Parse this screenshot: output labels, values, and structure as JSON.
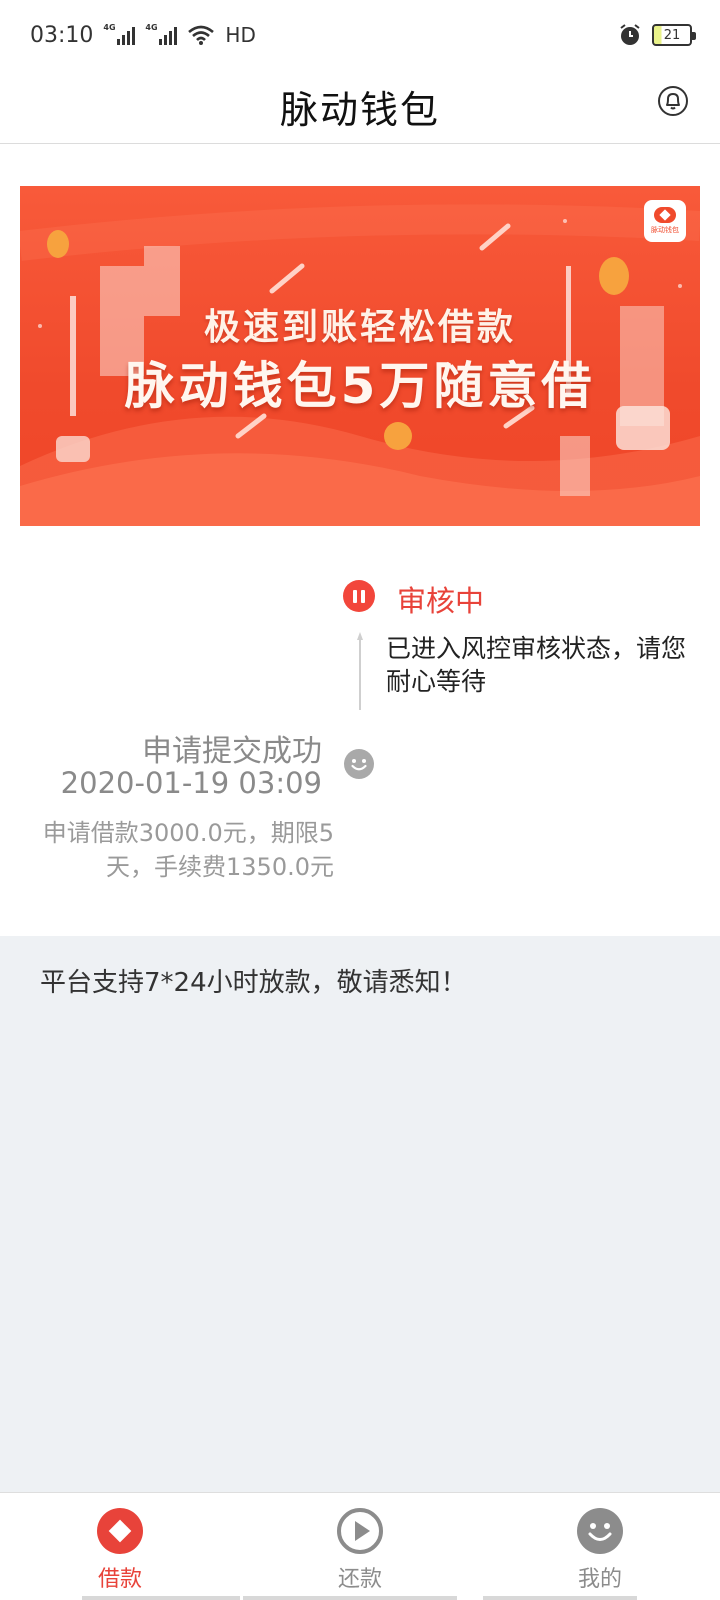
{
  "status_bar": {
    "time": "03:10",
    "network_1": "4G",
    "network_2": "4G",
    "hd": "HD",
    "battery": "21"
  },
  "header": {
    "title": "脉动钱包"
  },
  "banner": {
    "line1": "极速到账轻松借款",
    "line2": "脉动钱包5万随意借",
    "logo_text": "脉动钱包"
  },
  "timeline": {
    "current_status": "审核中",
    "current_desc": "已进入风控审核状态，请您耐心等待",
    "submitted_label": "申请提交成功",
    "submitted_time": "2020-01-19 03:09",
    "submitted_detail": "申请借款3000.0元，期限5天，手续费1350.0元"
  },
  "notice": {
    "text": "平台支持7*24小时放款，敬请悉知！"
  },
  "nav": {
    "items": [
      {
        "label": "借款",
        "icon": "loan-icon",
        "active": true
      },
      {
        "label": "还款",
        "icon": "play-icon",
        "active": false
      },
      {
        "label": "我的",
        "icon": "smile-face-icon",
        "active": false
      }
    ]
  },
  "colors": {
    "accent": "#e8433a",
    "banner": "#f04a2c",
    "notice_bg": "#eef1f4",
    "inactive": "#9a9a9a"
  }
}
